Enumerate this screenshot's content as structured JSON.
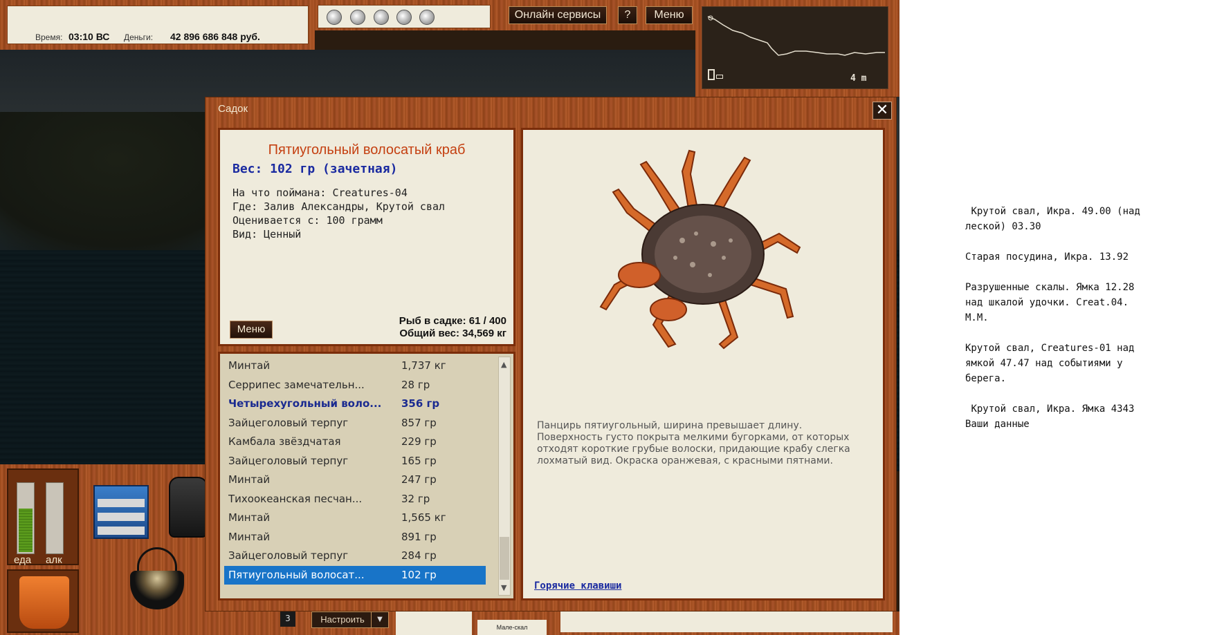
{
  "status": {
    "time_label": "Время:",
    "time_value": "03:10 ВС",
    "money_label": "Деньги:",
    "money_value": "42 896 686 848 руб."
  },
  "top_buttons": {
    "online": "Онлайн сервисы",
    "help": "?",
    "menu": "Меню"
  },
  "map": {
    "depth": "4 m"
  },
  "gauges": [
    {
      "label": "еда",
      "level": 0.62
    },
    {
      "label": "алк",
      "level": 0.0
    }
  ],
  "dialog": {
    "title": "Садок",
    "close": "✕",
    "fish_name": "Пятиугольный волосатый краб",
    "weight": "Вес: 102 гр (зачетная)",
    "caught_on": "На что поймана: Creatures-04",
    "location": "Где: Залив Александры, Крутой свал",
    "rated_from": "Оценивается с: 100 грамм",
    "kind": "Вид: Ценный",
    "menu_button": "Меню",
    "fish_count": "Рыб в садке: 61 / 400",
    "total_weight": "Общий вес: 34,569 кг",
    "description": "Панцирь пятиугольный, ширина превышает длину. Поверхность густо покрыта мелкими бугорками, от которых отходят короткие грубые волоски, придающие крабу слегка лохматый вид.  Окраска оранжевая, с красными пятнами.",
    "hotkeys": "Горячие клавиши",
    "list": [
      {
        "name": "Минтай",
        "weight": "1,737 кг",
        "style": ""
      },
      {
        "name": "Серрипес замечательн...",
        "weight": "28 гр",
        "style": ""
      },
      {
        "name": "Четырехугольный воло...",
        "weight": "356 гр",
        "style": "bold"
      },
      {
        "name": "Зайцеголовый терпуг",
        "weight": "857 гр",
        "style": ""
      },
      {
        "name": "Камбала звёздчатая",
        "weight": "229 гр",
        "style": ""
      },
      {
        "name": "Зайцеголовый терпуг",
        "weight": "165 гр",
        "style": ""
      },
      {
        "name": "Минтай",
        "weight": "247 гр",
        "style": ""
      },
      {
        "name": "Тихоокеанская песчан...",
        "weight": "32 гр",
        "style": ""
      },
      {
        "name": "Минтай",
        "weight": "1,565 кг",
        "style": ""
      },
      {
        "name": "Минтай",
        "weight": "891 гр",
        "style": ""
      },
      {
        "name": "Зайцеголовый терпуг",
        "weight": "284 гр",
        "style": ""
      },
      {
        "name": "Пятиугольный волосат...",
        "weight": "102 гр",
        "style": "sel"
      }
    ]
  },
  "bottom": {
    "settings": "Настроить",
    "small_label": "Мале-скал",
    "num": "3"
  },
  "notes": " Крутой свал, Икра. 49.00 (над\nлеской) 03.30\n\nСтарая посудина, Икра. 13.92\n\nРазрушенные скалы. Ямка 12.28\nнад шкалой удочки. Creat.04.\nМ.М.\n\nКрутой свал, Creatures-01 над\nямкой 47.47 над событиями у\nберега.\n\n Крутой свал, Икра. Ямка 4343\nВаши данные",
  "icons": [
    "bulb-icon",
    "tackle-box-icon",
    "backpack-icon",
    "bucket-icon",
    "cauldron-icon",
    "crab-image"
  ]
}
